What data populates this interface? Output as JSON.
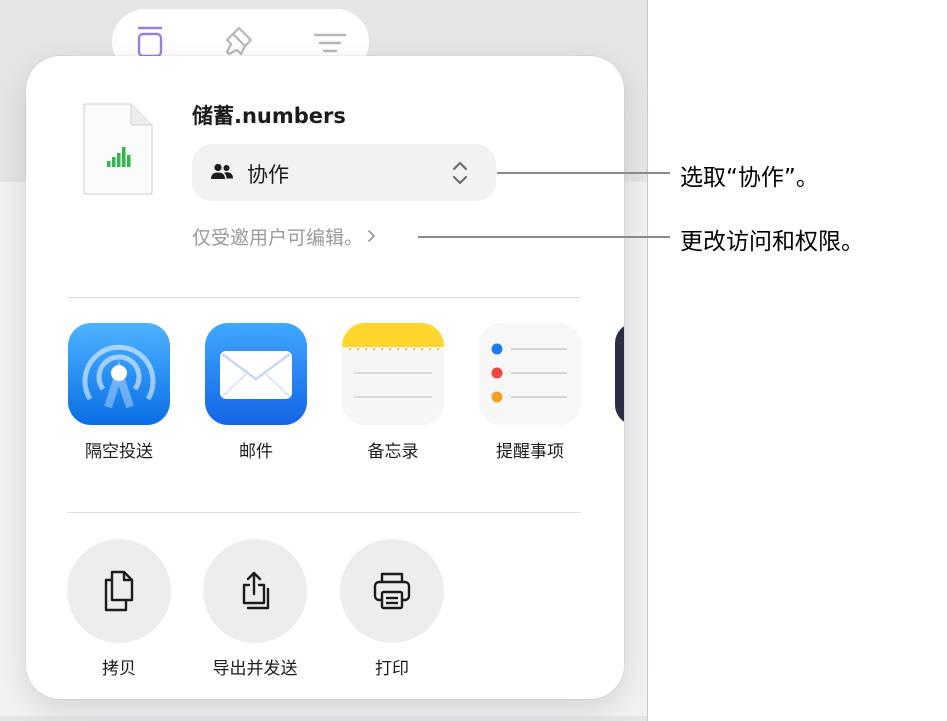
{
  "toolbar": {
    "tabs": [
      {
        "name": "document-tab",
        "icon": "document-icon",
        "selected": true
      },
      {
        "name": "format-tab",
        "icon": "paintbrush-icon",
        "selected": false
      },
      {
        "name": "organize-tab",
        "icon": "list-icon",
        "selected": false
      }
    ]
  },
  "share_sheet": {
    "document": {
      "title": "储蓄.numbers",
      "icon": "numbers-document-icon"
    },
    "collaboration": {
      "selected_value": "协作",
      "icon": "people-icon",
      "chevron_icon": "up-down-chevron-icon"
    },
    "access_summary": "仅受邀用户可编辑。",
    "apps": [
      {
        "label": "隔空投送",
        "icon": "airdrop-icon"
      },
      {
        "label": "邮件",
        "icon": "mail-icon"
      },
      {
        "label": "备忘录",
        "icon": "notes-icon"
      },
      {
        "label": "提醒事项",
        "icon": "reminders-icon"
      }
    ],
    "actions": [
      {
        "label": "拷贝",
        "icon": "copy-icon"
      },
      {
        "label": "导出并发送",
        "icon": "export-icon"
      },
      {
        "label": "打印",
        "icon": "print-icon"
      }
    ]
  },
  "callouts": [
    {
      "text": "选取“协作”。"
    },
    {
      "text": "更改访问和权限。"
    }
  ],
  "colors": {
    "accent_purple": "#9b7fdc",
    "numbers_green": "#2eb84a",
    "airdrop_blue": "#1a8cf0",
    "mail_blue": "#1f7ef0",
    "notes_yellow": "#ffd52e"
  }
}
